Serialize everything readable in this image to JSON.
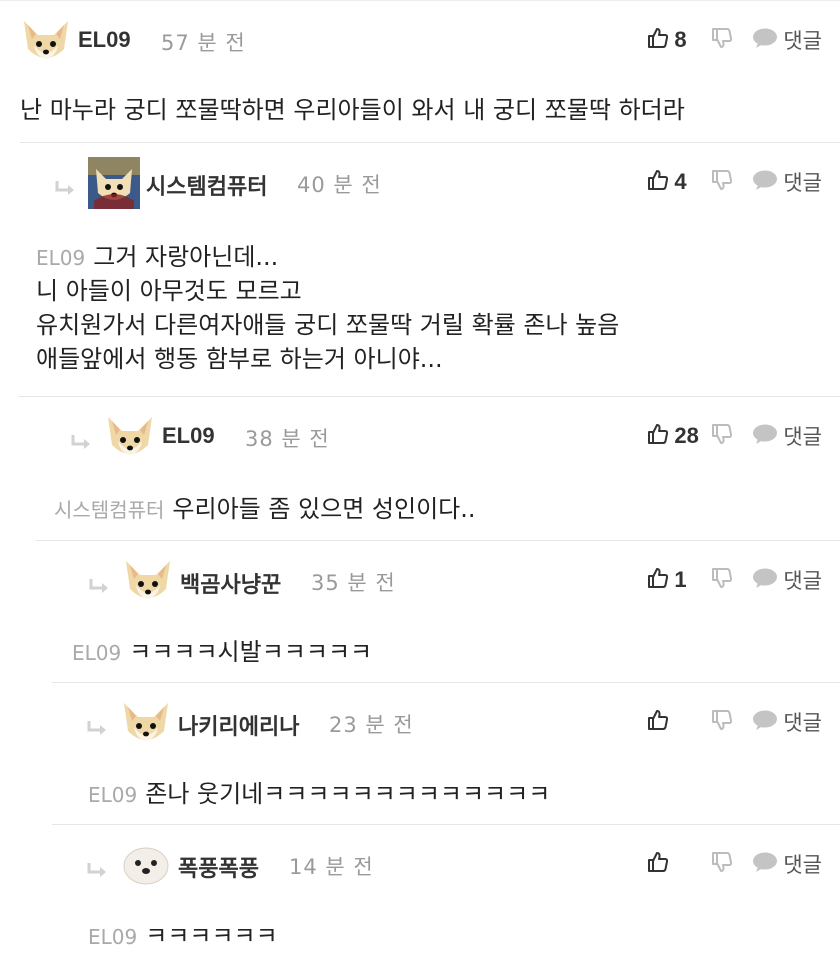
{
  "icons": {
    "like": "thumbs-up-icon",
    "dislike": "thumbs-down-icon",
    "reply": "speech-bubble-icon",
    "reply_arrow": "reply-arrow-icon"
  },
  "colors": {
    "text": "#222222",
    "muted": "#9a9a9a",
    "mention": "#a9a9a9",
    "icon": "#bcbcbc"
  },
  "reply_label": "댓글",
  "comments": [
    {
      "author": "EL09",
      "time": "57 분 전",
      "likes": "8",
      "mention": "",
      "lines": [
        "난 마누라 궁디 쪼물딱하면 우리아들이 와서 내 궁디 쪼물딱 하더라"
      ]
    },
    {
      "author": "시스템컴퓨터",
      "time": "40 분 전",
      "likes": "4",
      "mention": "EL09",
      "lines": [
        "그거 자랑아닌데...",
        "니 아들이 아무것도 모르고",
        "유치원가서 다른여자애들 궁디 쪼물딱 거릴 확률 존나 높음",
        "애들앞에서 행동 함부로 하는거 아니야..."
      ]
    },
    {
      "author": "EL09",
      "time": "38 분 전",
      "likes": "28",
      "mention": "시스템컴퓨터",
      "lines": [
        "우리아들 좀 있으면 성인이다.."
      ]
    },
    {
      "author": "백곰사냥꾼",
      "time": "35 분 전",
      "likes": "1",
      "mention": "EL09",
      "lines": [
        "ㅋㅋㅋㅋ시발ㅋㅋㅋㅋㅋ"
      ]
    },
    {
      "author": "나키리에리나",
      "time": "23 분 전",
      "likes": "",
      "mention": "EL09",
      "lines": [
        "존나 웃기네ㅋㅋㅋㅋㅋㅋㅋㅋㅋㅋㅋㅋㅋ"
      ]
    },
    {
      "author": "폭풍폭풍",
      "time": "14 분 전",
      "likes": "",
      "mention": "EL09",
      "lines": [
        "ㅋㅋㅋㅋㅋㅋ"
      ]
    }
  ]
}
